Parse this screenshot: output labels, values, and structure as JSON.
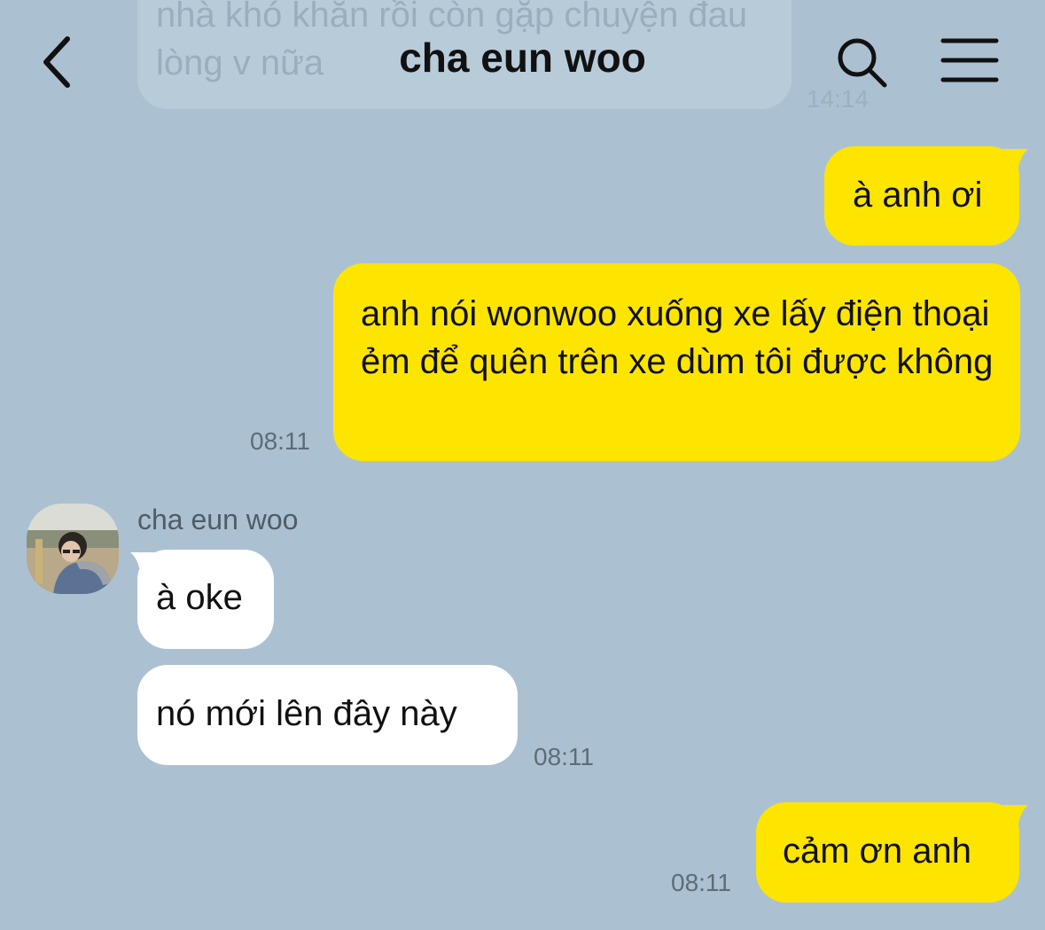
{
  "header": {
    "title": "cha eun woo",
    "back_icon": "chevron-left-icon",
    "search_icon": "search-icon",
    "menu_icon": "hamburger-menu-icon"
  },
  "previous_message": {
    "text": "nhà khó khăn rồi còn gặp chuyện đau lòng v nữa",
    "time": "14:14"
  },
  "messages": [
    {
      "sender": "me",
      "text": "à anh ơi"
    },
    {
      "sender": "me",
      "text": "anh nói wonwoo xuống xe lấy điện thoại ẻm để quên trên xe dùm tôi được không",
      "time": "08:11"
    },
    {
      "sender": "contact",
      "sender_name": "cha eun woo",
      "text": "à oke"
    },
    {
      "sender": "contact",
      "text": "nó mới lên đây này",
      "time": "08:11"
    },
    {
      "sender": "me",
      "text": "cảm ơn anh",
      "time": "08:11"
    }
  ],
  "colors": {
    "background": "#abc1d2",
    "my_bubble": "#fee500",
    "their_bubble": "#ffffff"
  }
}
